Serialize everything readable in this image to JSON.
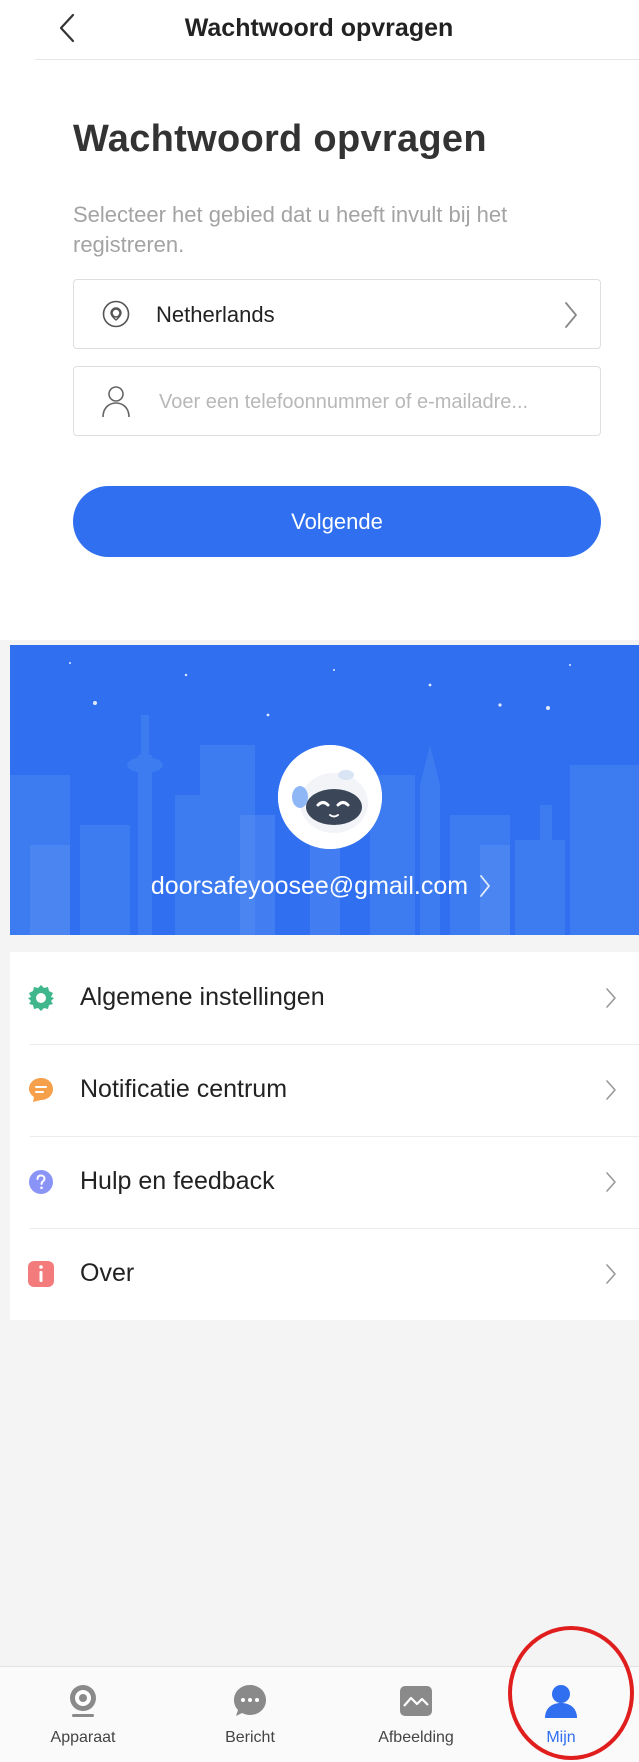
{
  "password_screen": {
    "nav_title": "Wachtwoord opvragen",
    "heading": "Wachtwoord opvragen",
    "hint": "Selecteer het gebied dat u heeft invult bij het registreren.",
    "region": "Netherlands",
    "account_placeholder": "Voer een telefoonnummer of e-mailadre...",
    "next_label": "Volgende"
  },
  "profile": {
    "email": "doorsafeyoosee@gmail.com",
    "menu": [
      {
        "label": "Algemene instellingen",
        "icon": "gear-icon",
        "color": "#3fb68b"
      },
      {
        "label": "Notificatie centrum",
        "icon": "message-icon",
        "color": "#f7a04b"
      },
      {
        "label": "Hulp en feedback",
        "icon": "help-icon",
        "color": "#8a94f7"
      },
      {
        "label": "Over",
        "icon": "info-icon",
        "color": "#f47b7b"
      }
    ]
  },
  "tabs": [
    {
      "label": "Apparaat",
      "icon": "camera-icon",
      "active": false
    },
    {
      "label": "Bericht",
      "icon": "chat-icon",
      "active": false
    },
    {
      "label": "Afbeelding",
      "icon": "image-icon",
      "active": false
    },
    {
      "label": "Mijn",
      "icon": "person-icon",
      "active": true
    }
  ],
  "colors": {
    "accent": "#2f6ff0",
    "highlight": "#e01e1e"
  }
}
